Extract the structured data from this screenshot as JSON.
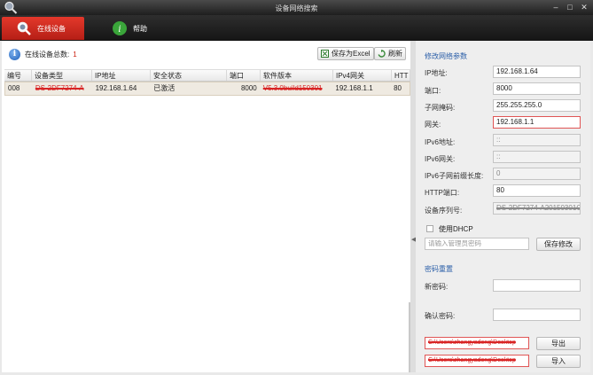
{
  "window": {
    "title": "设备网络搜索"
  },
  "tabs": {
    "online": "在线设备",
    "help": "帮助"
  },
  "toolbar": {
    "count_label": "在线设备总数:",
    "count_value": "1",
    "export_excel": "保存为Excel",
    "refresh": "刷新"
  },
  "table": {
    "headers": [
      "编号",
      "设备类型",
      "IP地址",
      "安全状态",
      "端口",
      "软件版本",
      "IPv4网关",
      "HTT"
    ],
    "rows": [
      {
        "index": "008",
        "type": "DS-2DF7274-A",
        "ip": "192.168.1.64",
        "status": "已激活",
        "port": "8000",
        "version": "V5.3.0build150301",
        "gateway": "192.168.1.1",
        "http": "80"
      }
    ]
  },
  "panel": {
    "section_network": "修改网络参数",
    "ip_label": "IP地址:",
    "ip_value": "192.168.1.64",
    "port_label": "端口:",
    "port_value": "8000",
    "mask_label": "子网掩码:",
    "mask_value": "255.255.255.0",
    "gateway_label": "网关:",
    "gateway_value": "192.168.1.1",
    "ipv6_label": "IPv6地址:",
    "ipv6_value": "::",
    "ipv6gw_label": "IPv6网关:",
    "ipv6gw_value": "::",
    "ipv6prefix_label": "IPv6子网前缀长度:",
    "ipv6prefix_value": "0",
    "http_label": "HTTP端口:",
    "http_value": "80",
    "serial_label": "设备序列号:",
    "serial_value": "DS-2DF7274-A20150301CCWR",
    "dhcp_label": "使用DHCP",
    "admin_pwd_placeholder": "请输入管理员密码",
    "save_btn": "保存修改",
    "section_reset": "密码重置",
    "new_pwd_label": "新密码:",
    "confirm_pwd_label": "确认密码:",
    "export_path": "C:\\Users\\zhangyadong\\Desktop",
    "import_path": "C:\\Users\\zhangyadong\\Desktop",
    "browse": "...",
    "export_btn": "导出",
    "import_btn": "导入"
  },
  "colors": {
    "accent_tab": "#d52a20",
    "section_blue": "#2a5ea8",
    "redaction": "#d82424"
  }
}
